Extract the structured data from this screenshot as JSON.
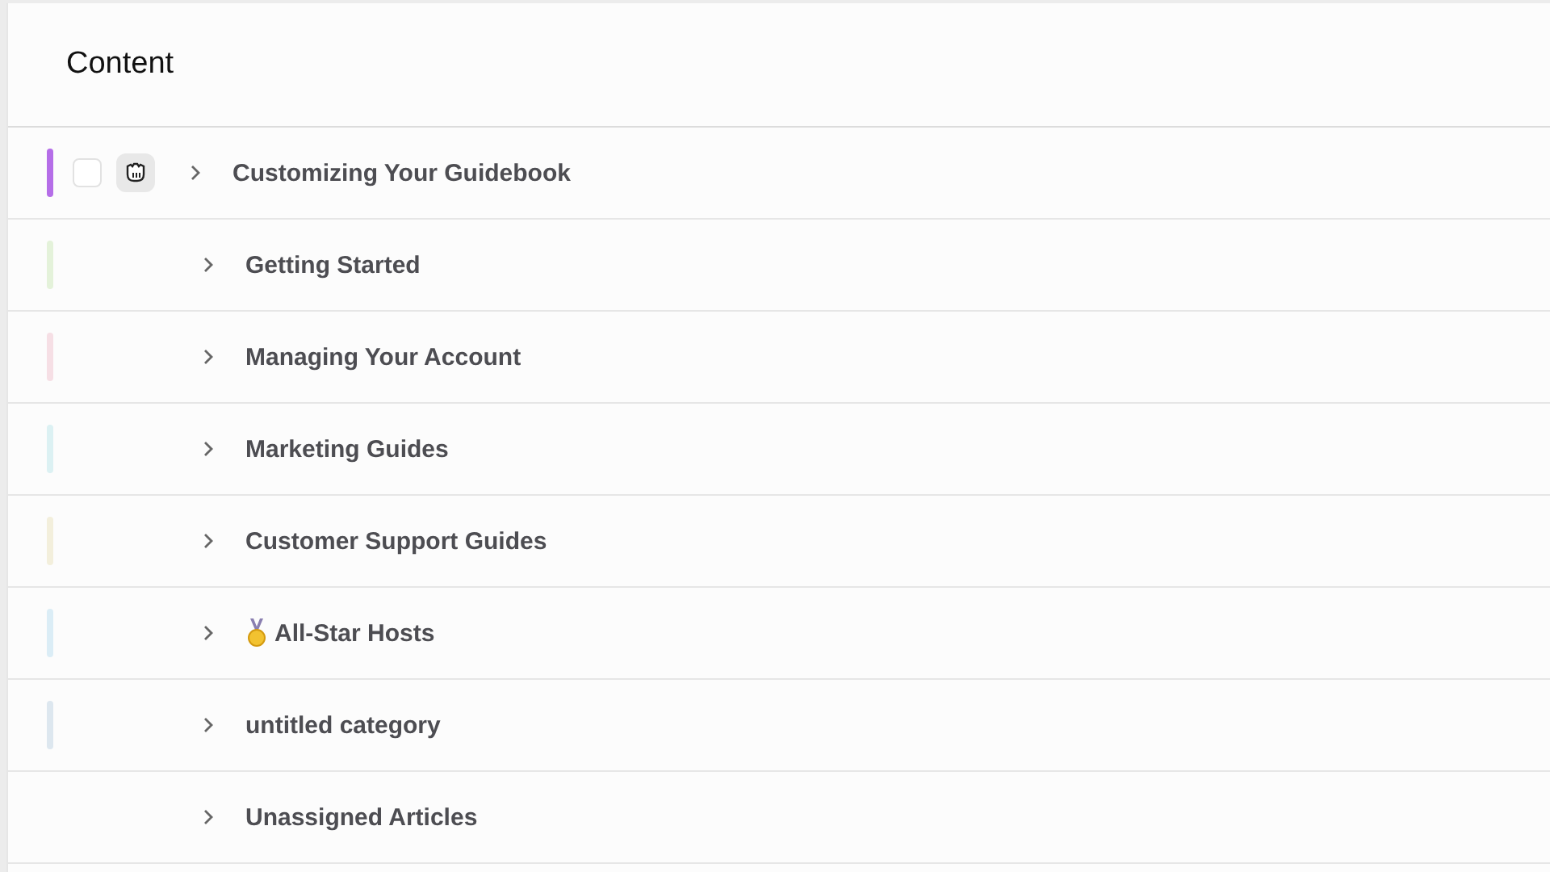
{
  "header": {
    "title": "Content"
  },
  "rows": [
    {
      "label": "Customizing Your Guidebook",
      "color": "#b56ee8",
      "kind": "plain",
      "hovered": true,
      "checked": false,
      "expanded": false
    },
    {
      "label": "Getting Started",
      "color": "#e4f2da",
      "kind": "plain",
      "hovered": false,
      "expanded": false
    },
    {
      "label": "Managing Your Account",
      "color": "#f6dfe5",
      "kind": "plain",
      "hovered": false,
      "expanded": false
    },
    {
      "label": "Marketing Guides",
      "color": "#dcf1f3",
      "kind": "plain",
      "hovered": false,
      "expanded": false
    },
    {
      "label": "Customer Support Guides",
      "color": "#f3efdc",
      "kind": "plain",
      "hovered": false,
      "expanded": false
    },
    {
      "label": "All-Star Hosts",
      "color": "#dbedf6",
      "kind": "medal",
      "hovered": false,
      "expanded": false
    },
    {
      "label": "untitled category",
      "color": "#dde7ef",
      "kind": "plain",
      "hovered": false,
      "expanded": false
    },
    {
      "label": "Unassigned Articles",
      "kind": "plain",
      "hovered": false,
      "expanded": false
    }
  ]
}
